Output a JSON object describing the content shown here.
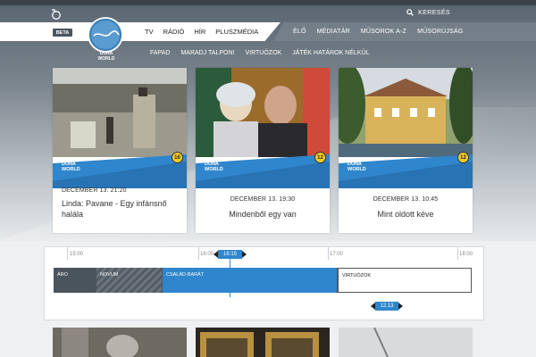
{
  "header": {
    "search_label": "KERESÉS",
    "beta": "BETA",
    "logo_text": [
      "DUNA",
      "WORLD"
    ],
    "main_nav": [
      "TV",
      "RÁDIÓ",
      "HÍR",
      "PLUSZMÉDIA"
    ],
    "right_nav": [
      "ÉLŐ",
      "MÉDIATÁR",
      "MŰSOROK A-Z",
      "MŰSORÚJSÁG"
    ],
    "sub_nav": [
      "FAPAD",
      "MARADJ TALPON!",
      "VIRTUÓZOK",
      "JÁTÉK HATÁROK NÉLKÜL"
    ]
  },
  "cards": [
    {
      "date": "DECEMBER 13. 21:20",
      "title": "Linda: Pavane - Egy infánsnő halála",
      "brand": [
        "DUNA",
        "WORLD"
      ],
      "badge": "16"
    },
    {
      "date": "DECEMBER 13. 19:30",
      "title": "Mindenből egy van",
      "brand": [
        "DUNA",
        "WORLD"
      ],
      "badge": "12"
    },
    {
      "date": "DECEMBER 13. 10:45",
      "title": "Mint oldott kéve",
      "brand": [
        "DUNA",
        "WORLD"
      ],
      "badge": "12"
    }
  ],
  "timeline": {
    "ticks": [
      "15:00",
      "16:00",
      "17:00",
      "18:00"
    ],
    "now": "16:15",
    "date": "12.13",
    "programs": [
      "ÁRO",
      "NOVUM",
      "CSALÁD-BARÁT",
      "VIRTUÓZOK"
    ]
  },
  "colors": {
    "accent": "#2f86cc",
    "rating_badge": "#f4cc27"
  }
}
